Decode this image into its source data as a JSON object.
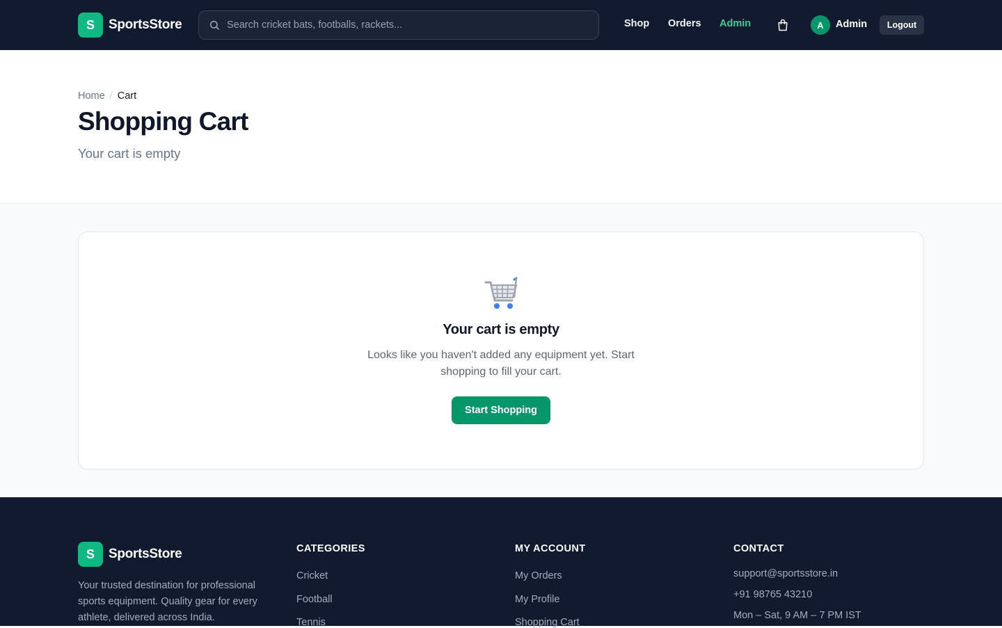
{
  "colors": {
    "header_bg": "#111a2e",
    "accent": "#10b981",
    "primary_button": "#059669",
    "active_nav": "#34d399",
    "page_bg": "#f8fafc"
  },
  "header": {
    "logo_letter": "S",
    "brand": "SportsStore",
    "search_placeholder": "Search cricket bats, footballs, rackets...",
    "nav": {
      "shop": "Shop",
      "orders": "Orders",
      "admin": "Admin"
    },
    "cart_icon": "shopping-bag-icon",
    "user_initial": "A",
    "user_name": "Admin",
    "logout": "Logout"
  },
  "breadcrumb": {
    "home": "Home",
    "separator": "/",
    "current": "Cart"
  },
  "page": {
    "title": "Shopping Cart",
    "subtitle": "Your cart is empty"
  },
  "empty_state": {
    "icon": "shopping-cart-icon",
    "title": "Your cart is empty",
    "message": "Looks like you haven't added any equipment yet. Start shopping to fill your cart.",
    "button": "Start Shopping"
  },
  "footer": {
    "logo_letter": "S",
    "brand": "SportsStore",
    "description": "Your trusted destination for professional sports equipment. Quality gear for every athlete, delivered across India.",
    "categories": {
      "heading": "CATEGORIES",
      "links": [
        "Cricket",
        "Football",
        "Tennis"
      ]
    },
    "account": {
      "heading": "MY ACCOUNT",
      "links": [
        "My Orders",
        "My Profile",
        "Shopping Cart"
      ]
    },
    "contact": {
      "heading": "CONTACT",
      "email": "support@sportsstore.in",
      "phone": "+91 98765 43210",
      "hours": "Mon – Sat, 9 AM – 7 PM IST"
    }
  }
}
